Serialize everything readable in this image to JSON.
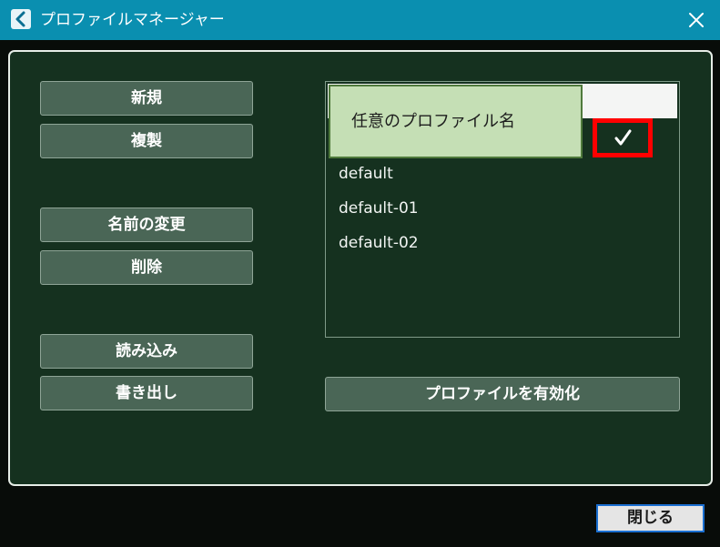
{
  "window": {
    "title": "プロファイルマネージャー",
    "close_button_label": "閉じる"
  },
  "actions": {
    "new_label": "新規",
    "duplicate_label": "複製",
    "rename_label": "名前の変更",
    "delete_label": "削除",
    "import_label": "読み込み",
    "export_label": "書き出し",
    "activate_label": "プロファイルを有効化"
  },
  "profile_list": {
    "items": [
      {
        "label": "default"
      },
      {
        "label": "default-01"
      },
      {
        "label": "default-02"
      }
    ],
    "selected_checked": true
  },
  "annotation": {
    "callout_text": "任意のプロファイル名",
    "highlight_color": "#ff0000"
  },
  "colors": {
    "titlebar": "#0a8fb0",
    "panel": "#15311f",
    "button": "#4a6656"
  }
}
